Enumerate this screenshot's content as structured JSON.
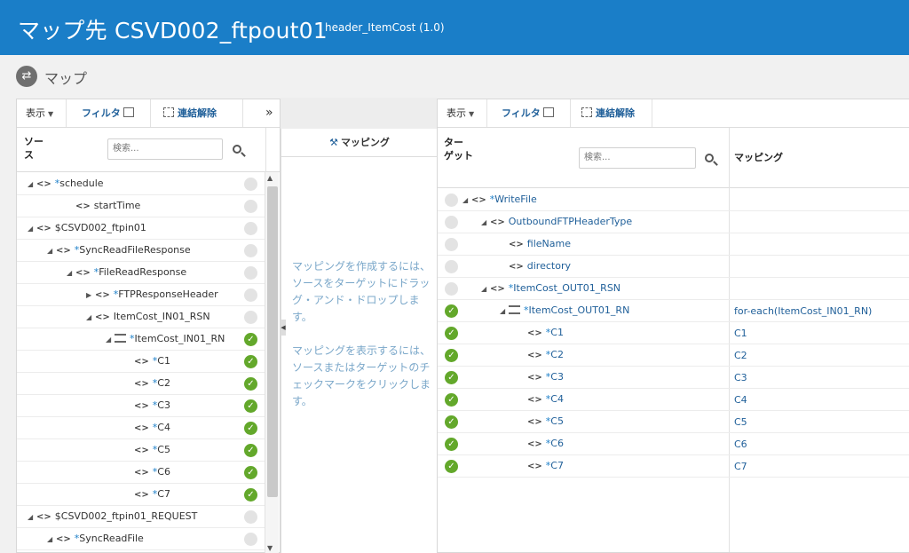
{
  "header": {
    "title": "マップ先 CSVD002_ftpout01",
    "subtitle": "header_ItemCost (1.0)"
  },
  "subbar": {
    "icon": "map-swap-icon",
    "label": "マップ"
  },
  "source_panel": {
    "toolbar": {
      "view": "表示",
      "filter": "フィルタ",
      "unlink": "連結解除",
      "expand": "»"
    },
    "column_label": "ソース",
    "search_placeholder": "検索...",
    "rows": [
      {
        "indent": 0,
        "expander": "◢",
        "star": true,
        "name": "schedule",
        "icon": "angle",
        "checked": false
      },
      {
        "indent": 2,
        "expander": "",
        "star": false,
        "name": "startTime",
        "icon": "angle",
        "checked": false
      },
      {
        "indent": 0,
        "expander": "◢",
        "star": false,
        "name": "$CSVD002_ftpin01",
        "icon": "angle",
        "checked": false
      },
      {
        "indent": 1,
        "expander": "◢",
        "star": true,
        "name": "SyncReadFileResponse",
        "icon": "angle",
        "checked": false
      },
      {
        "indent": 2,
        "expander": "◢",
        "star": true,
        "name": "FileReadResponse",
        "icon": "angle",
        "checked": false
      },
      {
        "indent": 3,
        "expander": "▶",
        "star": true,
        "name": "FTPResponseHeader",
        "icon": "angle",
        "checked": false
      },
      {
        "indent": 3,
        "expander": "◢",
        "star": false,
        "name": "ItemCost_IN01_RSN",
        "icon": "angle",
        "checked": false
      },
      {
        "indent": 4,
        "expander": "◢",
        "star": true,
        "name": "ItemCost_IN01_RN",
        "icon": "repeat",
        "checked": true
      },
      {
        "indent": 5,
        "expander": "",
        "star": true,
        "name": "C1",
        "icon": "angle",
        "checked": true
      },
      {
        "indent": 5,
        "expander": "",
        "star": true,
        "name": "C2",
        "icon": "angle",
        "checked": true
      },
      {
        "indent": 5,
        "expander": "",
        "star": true,
        "name": "C3",
        "icon": "angle",
        "checked": true
      },
      {
        "indent": 5,
        "expander": "",
        "star": true,
        "name": "C4",
        "icon": "angle",
        "checked": true
      },
      {
        "indent": 5,
        "expander": "",
        "star": true,
        "name": "C5",
        "icon": "angle",
        "checked": true
      },
      {
        "indent": 5,
        "expander": "",
        "star": true,
        "name": "C6",
        "icon": "angle",
        "checked": true
      },
      {
        "indent": 5,
        "expander": "",
        "star": true,
        "name": "C7",
        "icon": "angle",
        "checked": true
      },
      {
        "indent": 0,
        "expander": "◢",
        "star": false,
        "name": "$CSVD002_ftpin01_REQUEST",
        "icon": "angle",
        "checked": false
      },
      {
        "indent": 1,
        "expander": "◢",
        "star": true,
        "name": "SyncReadFile",
        "icon": "angle",
        "checked": false
      }
    ]
  },
  "mapping_panel": {
    "title": "マッピング",
    "para1": "マッピングを作成するには、ソースをターゲットにドラッグ・アンド・ドロップします。",
    "para2": "マッピングを表示するには、ソースまたはターゲットのチェックマークをクリックします。"
  },
  "target_panel": {
    "toolbar": {
      "view": "表示",
      "filter": "フィルタ",
      "unlink": "連結解除"
    },
    "column_label_line1": "ター",
    "column_label_line2": "ゲット",
    "search_placeholder": "検索...",
    "mapping_column": "マッピング",
    "rows": [
      {
        "indent": 0,
        "expander": "◢",
        "star": true,
        "name": "WriteFile",
        "icon": "angle",
        "checked": false,
        "mapping": ""
      },
      {
        "indent": 1,
        "expander": "◢",
        "star": false,
        "name": "OutboundFTPHeaderType",
        "icon": "angle",
        "checked": false,
        "mapping": ""
      },
      {
        "indent": 2,
        "expander": "",
        "star": false,
        "name": "fileName",
        "icon": "angle",
        "checked": false,
        "mapping": ""
      },
      {
        "indent": 2,
        "expander": "",
        "star": false,
        "name": "directory",
        "icon": "angle",
        "checked": false,
        "mapping": ""
      },
      {
        "indent": 1,
        "expander": "◢",
        "star": true,
        "name": "ItemCost_OUT01_RSN",
        "icon": "angle",
        "checked": false,
        "mapping": ""
      },
      {
        "indent": 2,
        "expander": "◢",
        "star": true,
        "name": "ItemCost_OUT01_RN",
        "icon": "repeat",
        "checked": true,
        "mapping": "for-each(ItemCost_IN01_RN)"
      },
      {
        "indent": 3,
        "expander": "",
        "star": true,
        "name": "C1",
        "icon": "angle",
        "checked": true,
        "mapping": "C1"
      },
      {
        "indent": 3,
        "expander": "",
        "star": true,
        "name": "C2",
        "icon": "angle",
        "checked": true,
        "mapping": "C2"
      },
      {
        "indent": 3,
        "expander": "",
        "star": true,
        "name": "C3",
        "icon": "angle",
        "checked": true,
        "mapping": "C3"
      },
      {
        "indent": 3,
        "expander": "",
        "star": true,
        "name": "C4",
        "icon": "angle",
        "checked": true,
        "mapping": "C4"
      },
      {
        "indent": 3,
        "expander": "",
        "star": true,
        "name": "C5",
        "icon": "angle",
        "checked": true,
        "mapping": "C5"
      },
      {
        "indent": 3,
        "expander": "",
        "star": true,
        "name": "C6",
        "icon": "angle",
        "checked": true,
        "mapping": "C6"
      },
      {
        "indent": 3,
        "expander": "",
        "star": true,
        "name": "C7",
        "icon": "angle",
        "checked": true,
        "mapping": "C7"
      }
    ]
  },
  "colors": {
    "header_bg": "#1a7ec8",
    "check_green": "#63a82b",
    "link_blue": "#1f5f99"
  }
}
